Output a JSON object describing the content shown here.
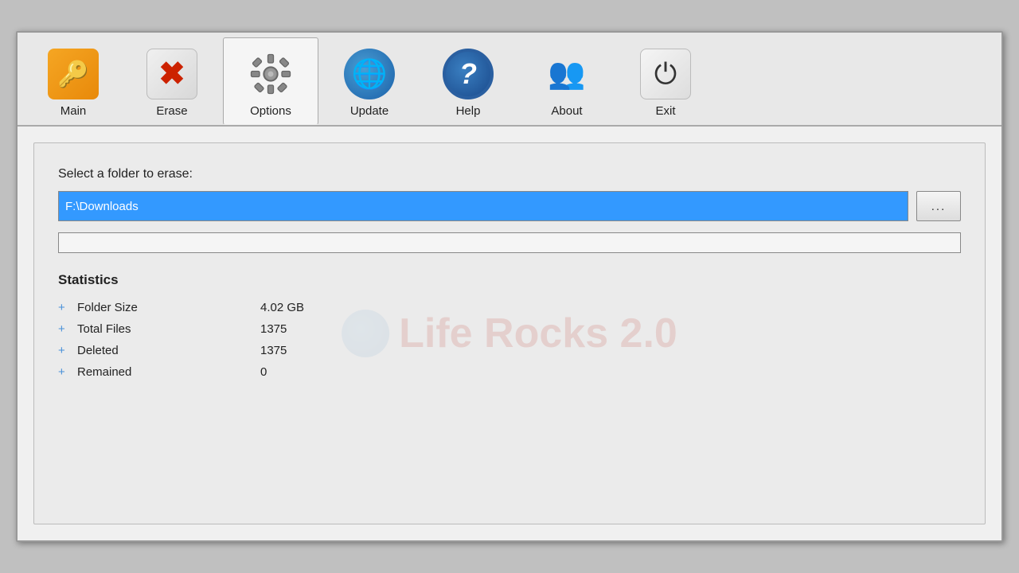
{
  "toolbar": {
    "buttons": [
      {
        "id": "main",
        "label": "Main"
      },
      {
        "id": "erase",
        "label": "Erase"
      },
      {
        "id": "options",
        "label": "Options"
      },
      {
        "id": "update",
        "label": "Update"
      },
      {
        "id": "help",
        "label": "Help"
      },
      {
        "id": "about",
        "label": "About"
      },
      {
        "id": "exit",
        "label": "Exit"
      }
    ],
    "active": "options"
  },
  "content": {
    "select_label": "Select a folder to erase:",
    "folder_path": "F:\\Downloads",
    "browse_btn_label": "...",
    "watermark_text": "Life Rocks 2.0",
    "statistics_title": "Statistics",
    "stats": [
      {
        "key": "Folder Size",
        "value": "4.02 GB"
      },
      {
        "key": "Total Files",
        "value": "1375"
      },
      {
        "key": "Deleted",
        "value": "1375"
      },
      {
        "key": "Remained",
        "value": "0"
      }
    ]
  }
}
